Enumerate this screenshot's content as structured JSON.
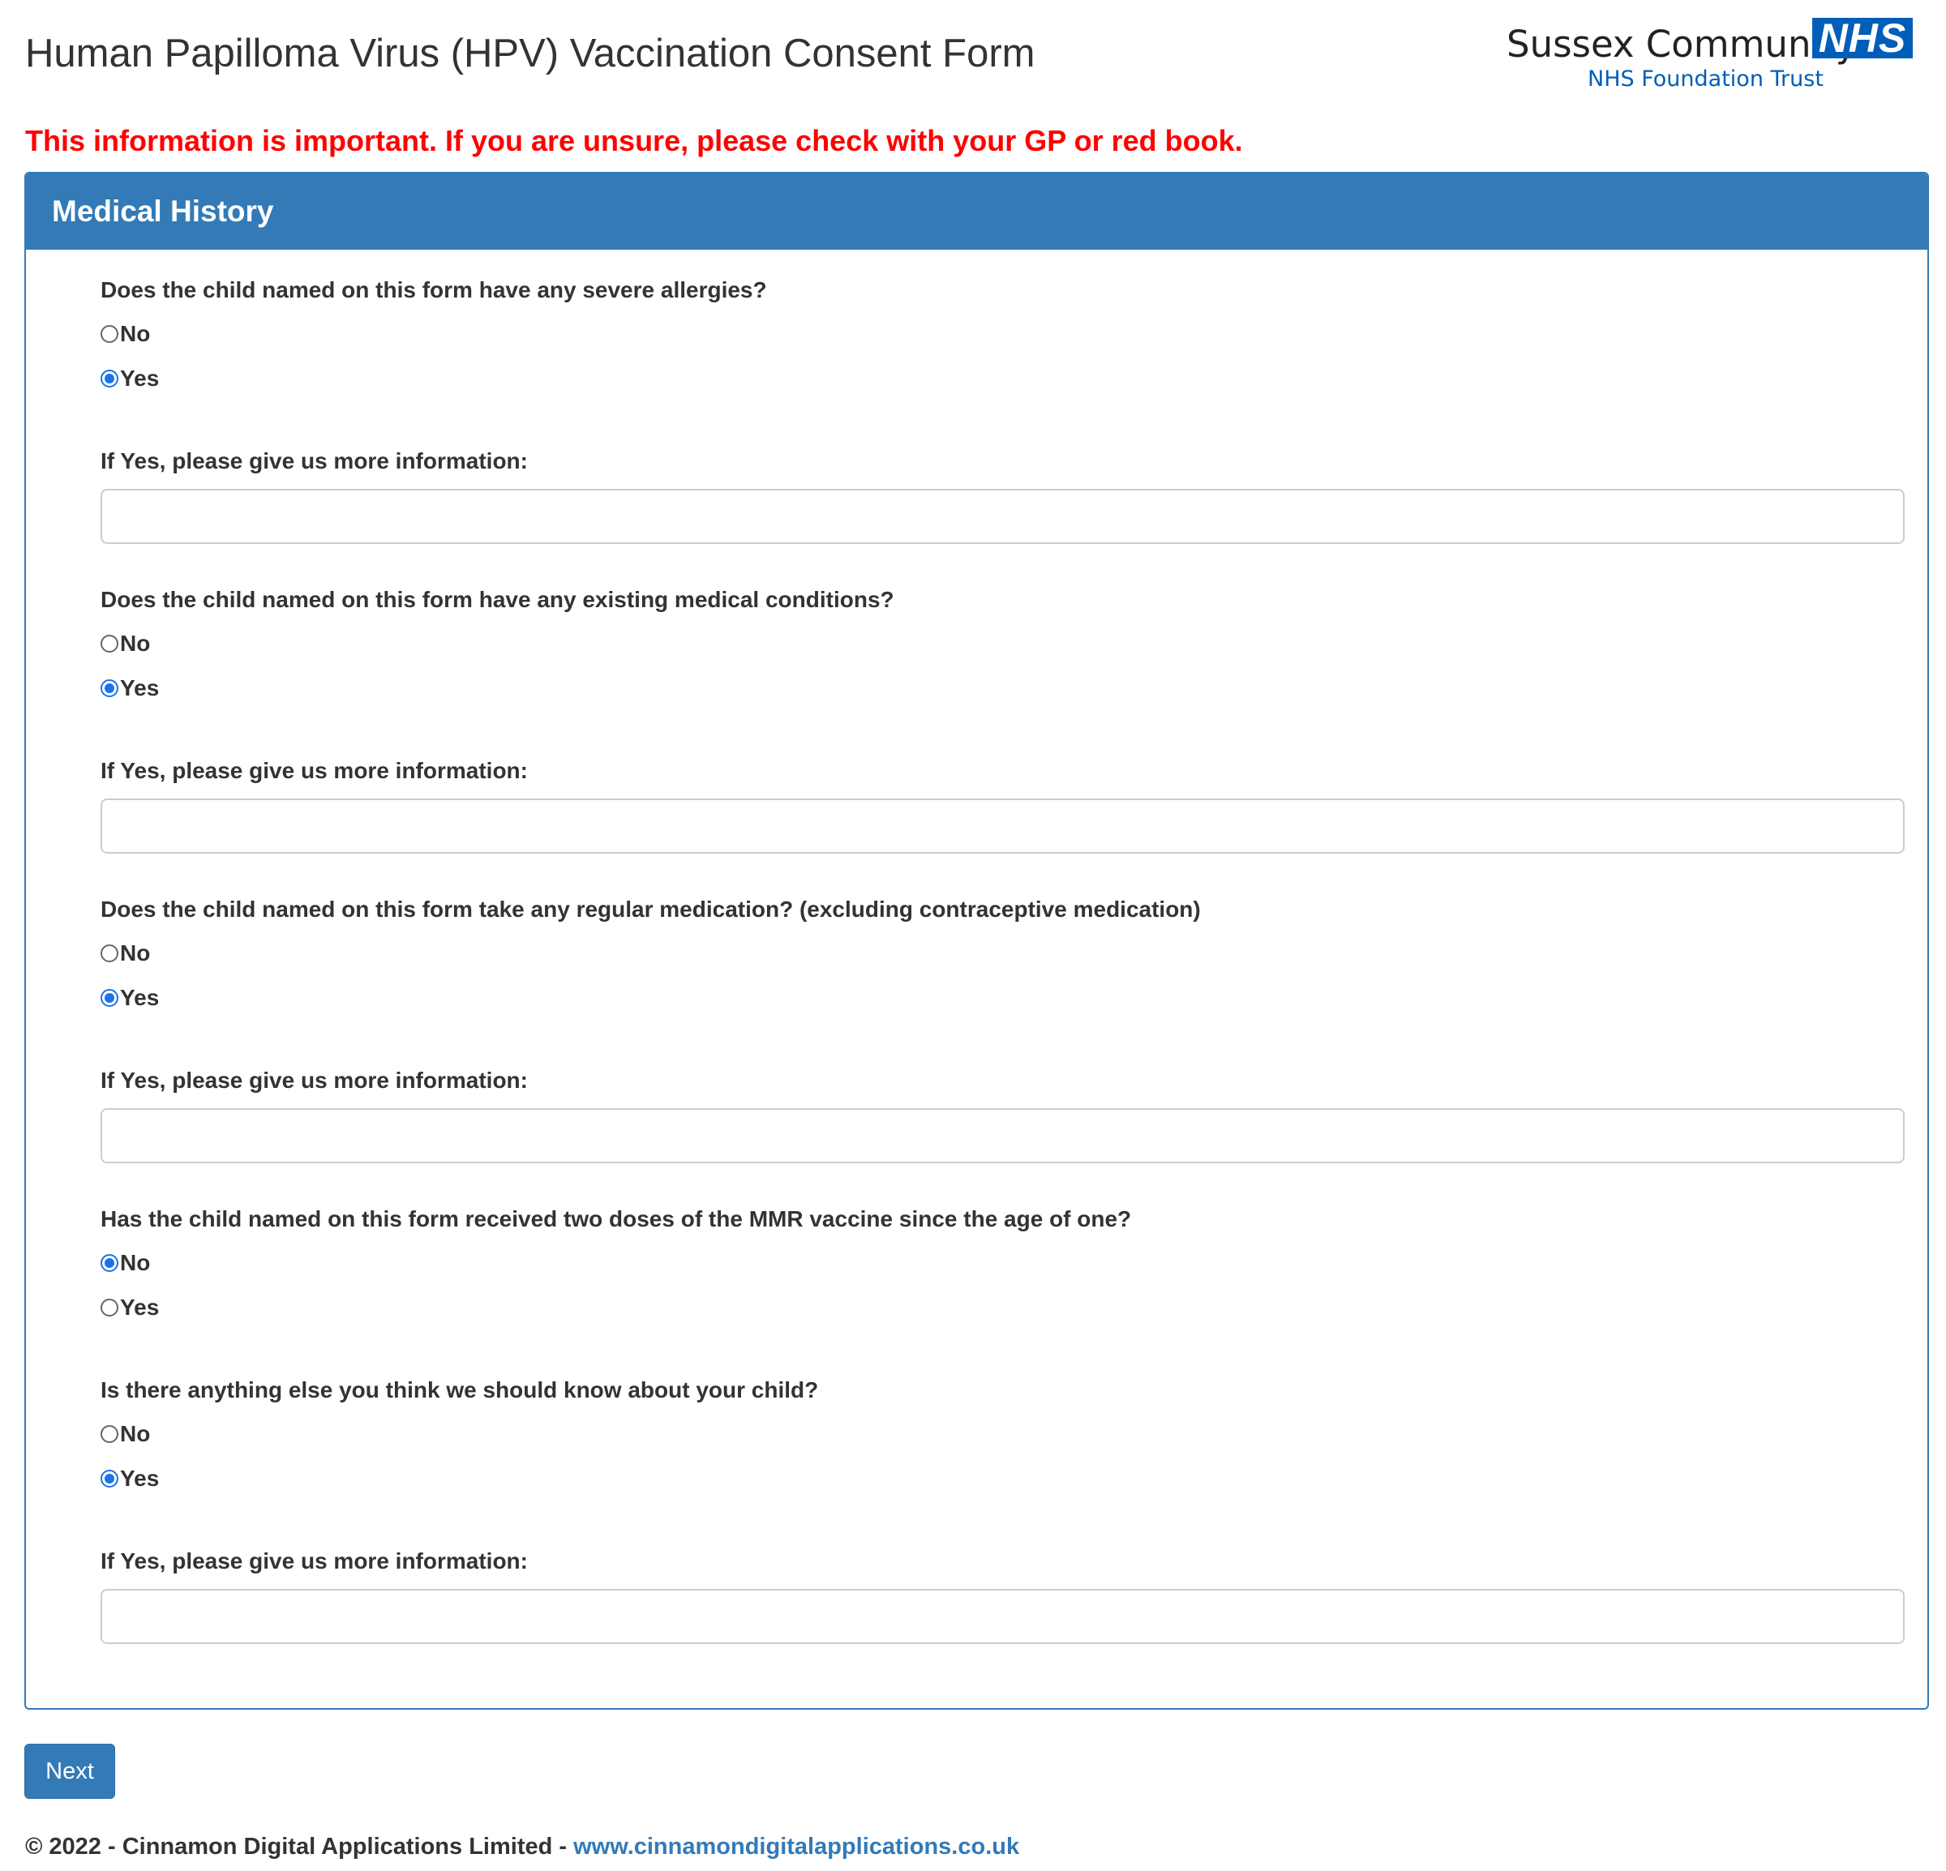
{
  "header": {
    "title": "Human Papilloma Virus (HPV) Vaccination Consent Form",
    "logo": {
      "org_name": "Sussex Community",
      "badge": "NHS",
      "trust": "NHS Foundation Trust",
      "badge_color": "#005EB8"
    }
  },
  "warning": "This information is important. If you are unsure, please check with your GP or red book.",
  "panel": {
    "heading": "Medical History",
    "questions": [
      {
        "text": "Does the child named on this form have any severe allergies?",
        "options": [
          "No",
          "Yes"
        ],
        "selected": "Yes",
        "followup_label": "If Yes, please give us more information:",
        "followup_value": ""
      },
      {
        "text": "Does the child named on this form have any existing medical conditions?",
        "options": [
          "No",
          "Yes"
        ],
        "selected": "Yes",
        "followup_label": "If Yes, please give us more information:",
        "followup_value": ""
      },
      {
        "text": "Does the child named on this form take any regular medication? (excluding contraceptive medication)",
        "options": [
          "No",
          "Yes"
        ],
        "selected": "Yes",
        "followup_label": "If Yes, please give us more information:",
        "followup_value": ""
      },
      {
        "text": "Has the child named on this form received two doses of the MMR vaccine since the age of one?",
        "options": [
          "No",
          "Yes"
        ],
        "selected": "No"
      },
      {
        "text": "Is there anything else you think we should know about your child?",
        "options": [
          "No",
          "Yes"
        ],
        "selected": "Yes",
        "followup_label": "If Yes, please give us more information:",
        "followup_value": ""
      }
    ]
  },
  "next_label": "Next",
  "footer": {
    "copyright": "© 2022 - Cinnamon Digital Applications Limited - ",
    "link": "www.cinnamondigitalapplications.co.uk"
  },
  "colors": {
    "primary": "#337ab7",
    "warning": "#ff0000",
    "radio_checked": "#1a73e8"
  }
}
